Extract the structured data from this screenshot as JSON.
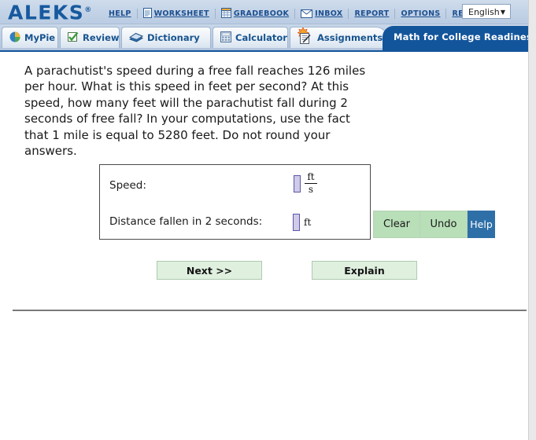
{
  "header": {
    "logo": "ALEKS",
    "logo_mark": "®",
    "links": [
      {
        "label": "HELP",
        "icon": null
      },
      {
        "label": "WORKSHEET",
        "icon": "document-icon"
      },
      {
        "label": "GRADEBOOK",
        "icon": "gradebook-icon"
      },
      {
        "label": "INBOX",
        "icon": "envelope-icon"
      },
      {
        "label": "REPORT",
        "icon": null
      },
      {
        "label": "OPTIONS",
        "icon": null
      },
      {
        "label": "RESOURCES",
        "icon": null
      }
    ],
    "language": {
      "value": "English",
      "caret": "▼"
    }
  },
  "tabs": [
    {
      "label": "MyPie",
      "icon": "pie-chart-icon"
    },
    {
      "label": "Review",
      "icon": "check-clipboard-icon"
    },
    {
      "label": "Dictionary",
      "icon": "book-icon"
    },
    {
      "label": "Calculator",
      "icon": "calculator-icon"
    },
    {
      "label": "Assignments",
      "icon": "assignment-star-icon"
    }
  ],
  "course": {
    "name": "Math for College Readiness"
  },
  "problem": {
    "text": "A parachutist's speed during a free fall reaches 126 miles per hour. What is this speed in feet per second? At this speed, how many feet will the parachutist fall during 2 seconds of free fall? In your computations, use the fact that 1 mile is equal to 5280 feet. Do not round your answers."
  },
  "answer_panel": {
    "rows": [
      {
        "label": "Speed:",
        "value": "",
        "unit_type": "fraction",
        "unit_numerator": "ft",
        "unit_denominator": "s"
      },
      {
        "label": "Distance fallen in 2 seconds:",
        "value": "",
        "unit_type": "plain",
        "unit": "ft"
      }
    ]
  },
  "side_buttons": [
    {
      "label": "Clear",
      "style": "green"
    },
    {
      "label": "Undo",
      "style": "green"
    },
    {
      "label": "Help",
      "style": "blue"
    }
  ],
  "bottom_buttons": [
    {
      "label": "Next >>"
    },
    {
      "label": "Explain"
    }
  ],
  "colors": {
    "brand_blue": "#13559b",
    "logo_blue": "#17599e",
    "header_bg": "#c2d2e6",
    "button_green": "#b8dfb8",
    "button_blue": "#2f6fa8",
    "input_fill": "#cfcbe8",
    "input_border": "#5b57a8",
    "bottom_button_bg": "#dff0df"
  }
}
